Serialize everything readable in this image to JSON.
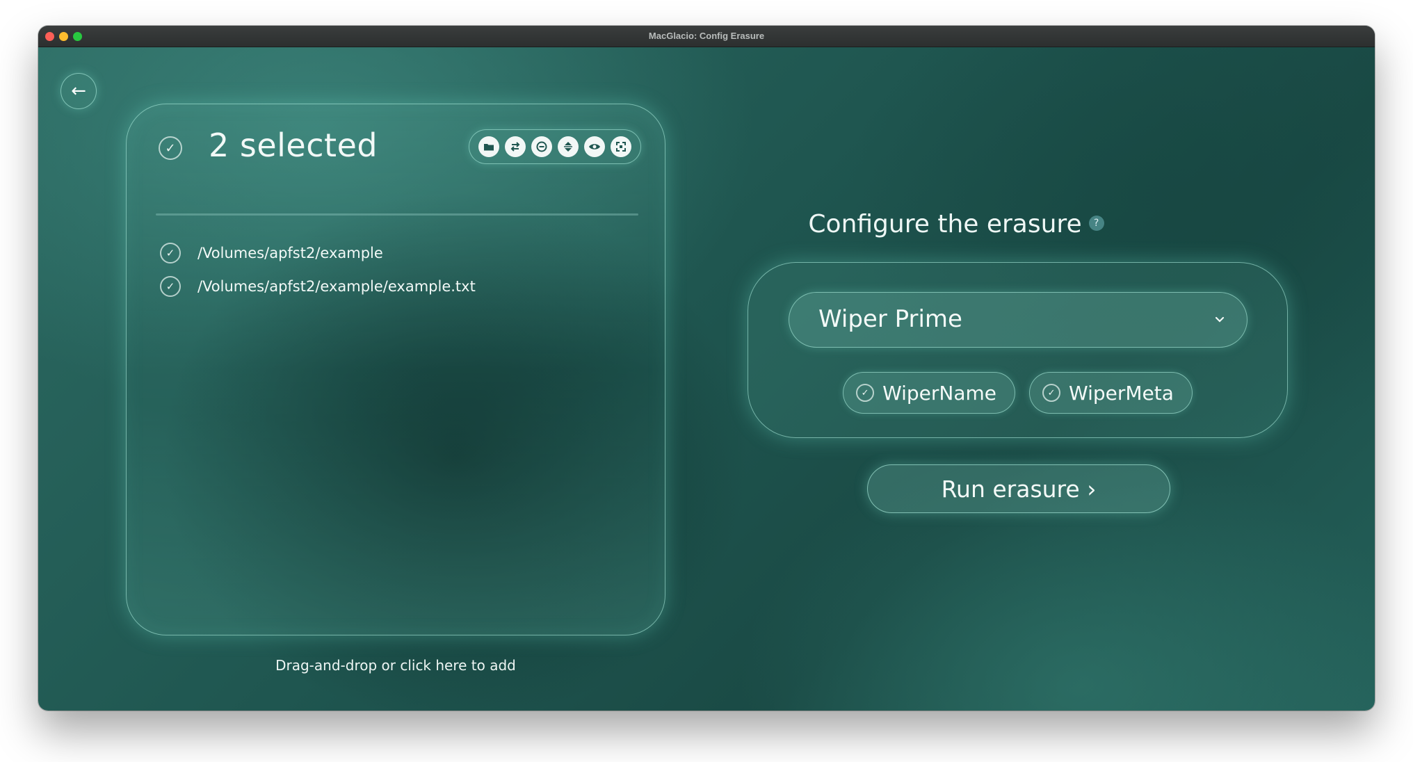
{
  "window": {
    "title": "MacGlacio: Config Erasure"
  },
  "back": {
    "icon": "←"
  },
  "selection": {
    "count_label": "2 selected",
    "check_icon": "✓"
  },
  "toolbar": {
    "icons": [
      "folder-icon",
      "swap-icon",
      "remove-icon",
      "sort-icon",
      "eye-icon",
      "select-all-icon"
    ]
  },
  "files": [
    {
      "path": "/Volumes/apfst2/example"
    },
    {
      "path": "/Volumes/apfst2/example/example.txt"
    }
  ],
  "drop_hint": "Drag-and-drop or click here to add",
  "config": {
    "title": "Configure the erasure",
    "help": "?",
    "wiper": {
      "selected": "Wiper Prime"
    },
    "options": [
      {
        "label": "WiperName",
        "checked": true
      },
      {
        "label": "WiperMeta",
        "checked": true
      }
    ]
  },
  "run_button": {
    "label": "Run erasure ›"
  },
  "colors": {
    "accent_glow": "#6edcc8",
    "background": "#1f5650",
    "text": "#eef7f5"
  }
}
